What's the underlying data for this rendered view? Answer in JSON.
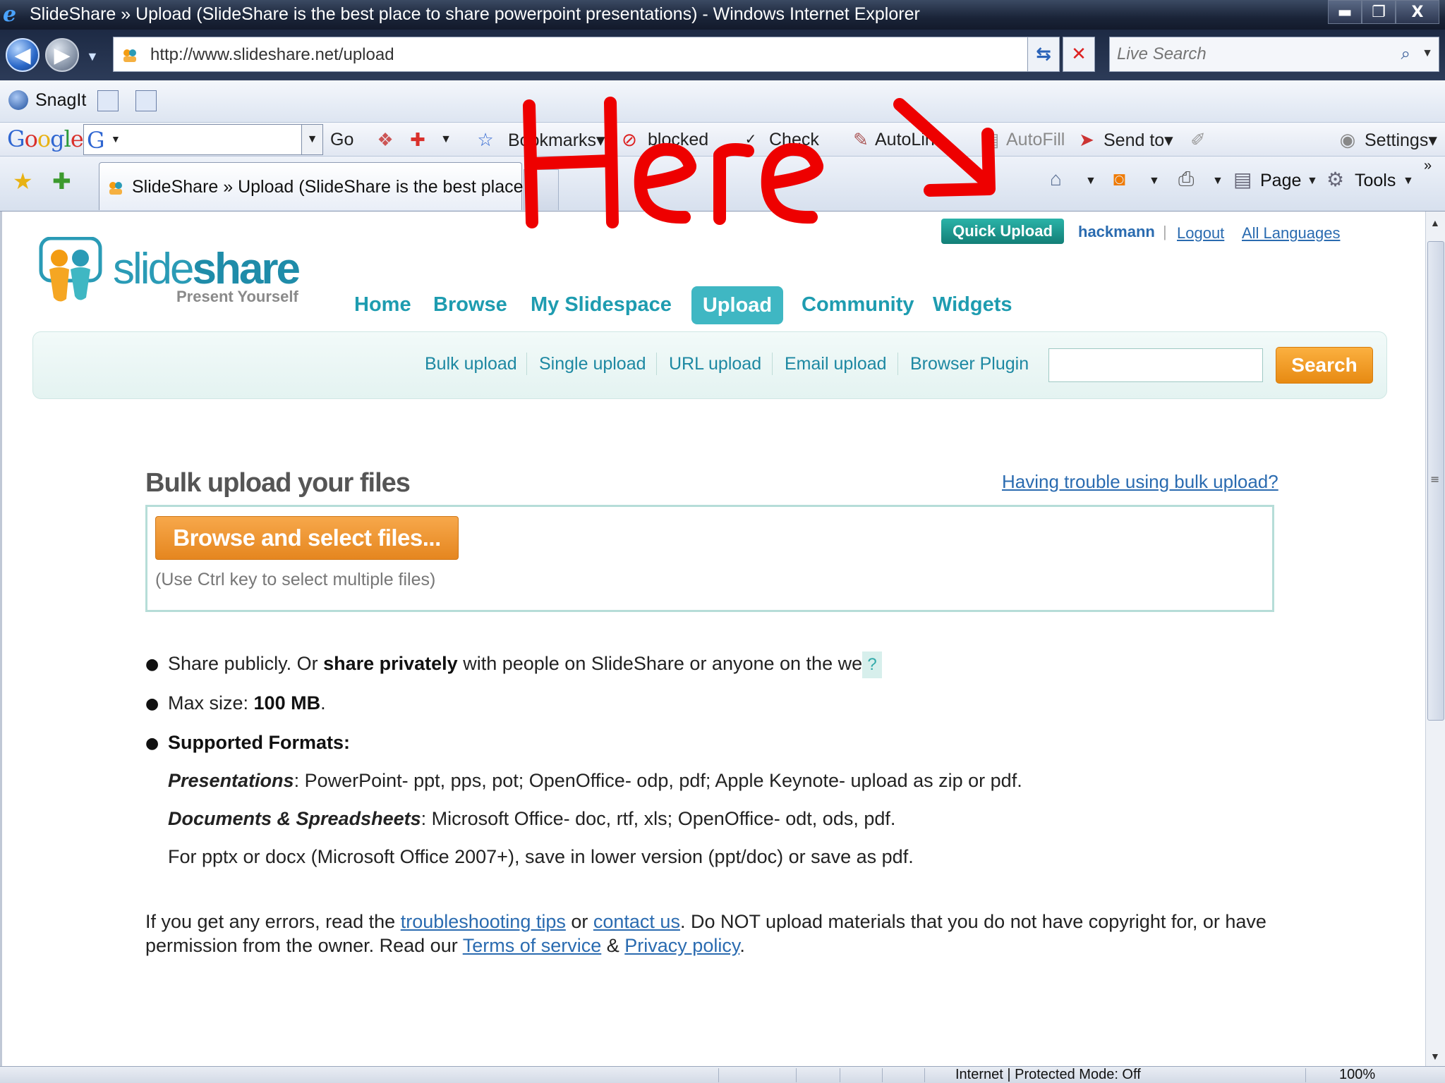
{
  "window": {
    "title": "SlideShare » Upload (SlideShare is the best place to share powerpoint presentations) - Windows Internet Explorer",
    "minimize": "▬",
    "restore": "❐",
    "close": "X"
  },
  "address_bar": {
    "url": "http://www.slideshare.net/upload",
    "search_placeholder": "Live Search"
  },
  "snagit_toolbar": {
    "label": "SnagIt"
  },
  "google_toolbar": {
    "logo": "Google",
    "go": "Go",
    "bookmarks": "Bookmarks▾",
    "popup_blocked": "blocked",
    "check": "Check",
    "autolink": "AutoLink",
    "autofill": "AutoFill",
    "send_to": "Send to▾",
    "settings": "Settings▾"
  },
  "tabs": [
    {
      "label": "SlideShare » Upload (SlideShare is the best place t..."
    }
  ],
  "command_bar": {
    "page": "Page",
    "tools": "Tools",
    "more": "»"
  },
  "site": {
    "logo_word": "slide",
    "logo_word_bold": "share",
    "tagline": "Present Yourself",
    "quick_upload": "Quick Upload",
    "username": "hackmann",
    "logout": "Logout",
    "all_languages": "All Languages",
    "nav": [
      "Home",
      "Browse",
      "My Slidespace",
      "Upload",
      "Community",
      "Widgets"
    ],
    "active_nav": "Upload",
    "subnav": [
      "Bulk upload",
      "Single upload",
      "URL upload",
      "Email upload",
      "Browser Plugin"
    ],
    "search_button": "Search"
  },
  "upload": {
    "title": "Bulk upload your files",
    "trouble_link": "Having trouble using bulk upload?",
    "browse_button": "Browse and select files...",
    "ctrl_hint": "(Use Ctrl key to select multiple files)",
    "share_pre": "Share publicly. Or ",
    "share_bold": "share privately",
    "share_post": " with people on SlideShare or anyone on the web.",
    "help_mark": "?",
    "maxsize_pre": "Max size: ",
    "maxsize_val": "100 MB",
    "maxsize_post": ".",
    "formats_heading": "Supported Formats:",
    "presentations_label": "Presentations",
    "presentations_text": ": PowerPoint- ppt, pps, pot; OpenOffice- odp, pdf; Apple Keynote- upload as zip or pdf.",
    "documents_label": "Documents & Spreadsheets",
    "documents_text": ": Microsoft Office- doc, rtf, xls; OpenOffice- odt, ods, pdf.",
    "pptx_note": "For pptx or docx (Microsoft Office 2007+), save in lower version (ppt/doc) or save as pdf.",
    "errors_pre": "If you get any errors, read the ",
    "troubleshooting_link": "troubleshooting tips",
    "errors_or": " or ",
    "contact_link": "contact us",
    "errors_post": ". Do NOT upload materials that you do not have copyright for, or have",
    "permission_pre": "permission from the owner. Read our ",
    "terms_link": "Terms of service",
    "amp": " & ",
    "privacy_link": "Privacy policy",
    "period": "."
  },
  "status_bar": {
    "zone": "Internet | Protected Mode: Off",
    "zoom": "100%"
  },
  "annotation": {
    "text": "Here",
    "color": "#ee0000"
  }
}
